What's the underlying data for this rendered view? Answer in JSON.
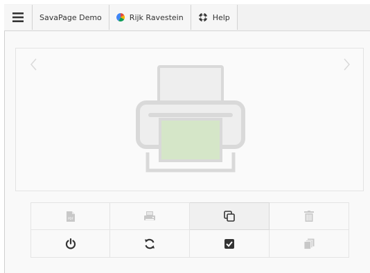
{
  "topbar": {
    "menu_icon": "hamburger-icon",
    "demo_label": "SavaPage Demo",
    "user_label": "Rijk Ravestein",
    "user_icon": "user-color-circle-icon",
    "help_label": "Help",
    "help_icon": "lifebuoy-icon"
  },
  "preview": {
    "prev_icon": "chevron-left-icon",
    "next_icon": "chevron-right-icon",
    "placeholder_icon": "printer-icon"
  },
  "actions": {
    "row1": [
      {
        "icon": "pdf-file-icon",
        "enabled": false
      },
      {
        "icon": "print-icon",
        "enabled": false
      },
      {
        "icon": "copy-pages-icon",
        "enabled": true
      },
      {
        "icon": "trash-icon",
        "enabled": false
      }
    ],
    "row2": [
      {
        "icon": "power-icon",
        "enabled": true
      },
      {
        "icon": "refresh-icon",
        "enabled": true
      },
      {
        "icon": "checkbox-checked-icon",
        "enabled": true
      },
      {
        "icon": "stacked-pages-icon",
        "enabled": false
      }
    ]
  },
  "colors": {
    "icon_active": "#333333",
    "icon_disabled": "#c8c8c8",
    "printer_body": "#d9d9d9",
    "printer_paper": "#d5e6c8",
    "printer_sheet": "#eeeeee"
  }
}
